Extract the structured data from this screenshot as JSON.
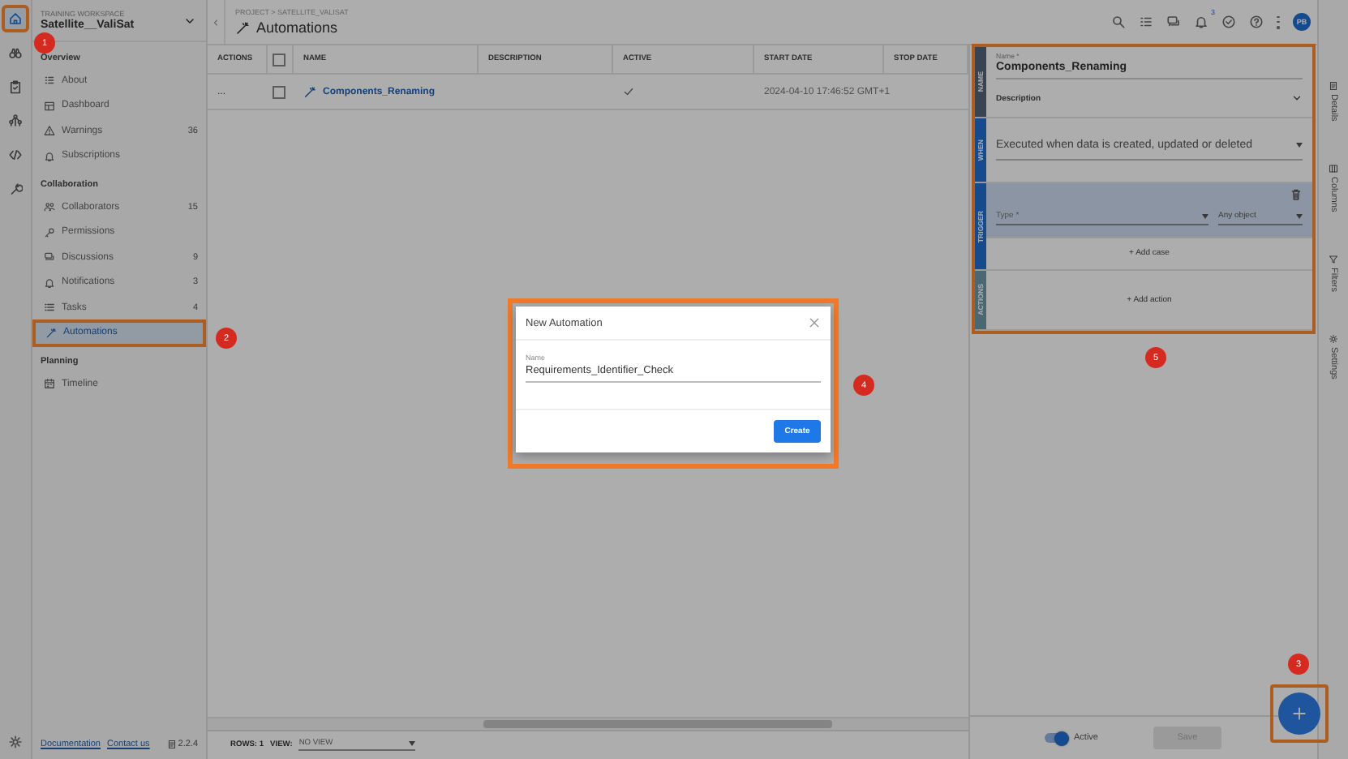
{
  "rail": {
    "items": [
      {
        "selected": true,
        "highlighted": true
      },
      {
        "selected": false,
        "highlighted": false
      },
      {
        "selected": false,
        "highlighted": false
      },
      {
        "selected": false,
        "highlighted": false
      },
      {
        "selected": false,
        "highlighted": false
      },
      {
        "selected": false,
        "highlighted": false
      }
    ]
  },
  "sidebar": {
    "workspace_label": "TRAINING WORKSPACE",
    "workspace": "Satellite__ValiSat",
    "sections": [
      {
        "title": "Overview",
        "items": [
          {
            "label": "About",
            "selected": false,
            "highlighted": false
          },
          {
            "label": "Dashboard",
            "selected": false,
            "highlighted": false
          },
          {
            "label": "Warnings",
            "count": "36",
            "selected": false,
            "highlighted": false
          },
          {
            "label": "Subscriptions",
            "selected": false,
            "highlighted": false
          }
        ]
      },
      {
        "title": "Collaboration",
        "items": [
          {
            "label": "Collaborators",
            "count": "15",
            "selected": false,
            "highlighted": false
          },
          {
            "label": "Permissions",
            "selected": false,
            "highlighted": false
          },
          {
            "label": "Discussions",
            "count": "9",
            "selected": false,
            "highlighted": false
          },
          {
            "label": "Notifications",
            "count": "3",
            "selected": false,
            "highlighted": false
          },
          {
            "label": "Tasks",
            "count": "4",
            "selected": false,
            "highlighted": false
          },
          {
            "label": "Automations",
            "selected": true,
            "highlighted": true
          }
        ]
      },
      {
        "title": "Planning",
        "items": [
          {
            "label": "Timeline",
            "selected": false,
            "highlighted": false
          }
        ]
      }
    ],
    "footer": {
      "links": [
        "Documentation",
        "Contact us"
      ],
      "version": "2.2.4"
    }
  },
  "header": {
    "breadcrumb": "PROJECT > SATELLITE_VALISAT",
    "title": "Automations",
    "notification_count": "3",
    "avatar": "PB"
  },
  "table": {
    "all_checked": false,
    "columns": [
      "ACTIONS",
      "NAME",
      "DESCRIPTION",
      "ACTIVE",
      "START DATE",
      "STOP DATE"
    ],
    "rows": [
      {
        "actions": "...",
        "checked": false,
        "name": "Components_Renaming",
        "active": true,
        "start_date": "2024-04-10 17:46:52 GMT+1"
      }
    ]
  },
  "bottom_bar": {
    "rows": "ROWS: 1",
    "view_label": "VIEW:",
    "view": "NO VIEW"
  },
  "panel": {
    "highlighted": true,
    "sections": [
      {
        "kind": "name",
        "label": "NAME",
        "name_label": "Name *",
        "name": "Components_Renaming",
        "description": "Description"
      },
      {
        "kind": "when",
        "label": "WHEN",
        "value": "Executed when data is created, updated or deleted"
      },
      {
        "kind": "trigger",
        "label": "TRIGGER",
        "type_placeholder": "Type *",
        "object": "Any object",
        "add": "+ Add case"
      },
      {
        "kind": "actions",
        "label": "ACTIONS",
        "add": "+ Add action"
      }
    ],
    "active": {
      "label": "Active",
      "on": true
    },
    "save": {
      "label": "Save",
      "disabled": true
    }
  },
  "side_tabs": [
    {
      "label": "Details"
    },
    {
      "label": "Columns"
    },
    {
      "label": "Filters"
    },
    {
      "label": "Settings"
    }
  ],
  "fab": {
    "highlighted": true
  },
  "dialog": {
    "title": "New Automation",
    "field_label": "Name",
    "value": "Requirements_Identifier_Check",
    "button": "Create",
    "highlighted": true
  },
  "callouts": [
    {
      "number": "1"
    },
    {
      "number": "2"
    },
    {
      "number": "3"
    },
    {
      "number": "4"
    },
    {
      "number": "5"
    }
  ]
}
